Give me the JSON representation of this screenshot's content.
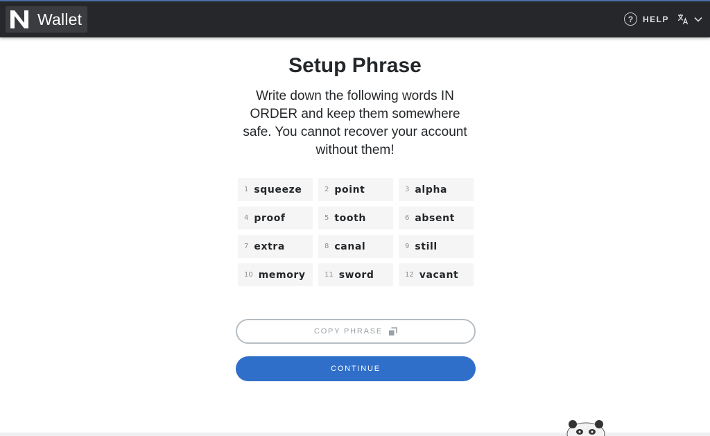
{
  "header": {
    "brand_text": "Wallet",
    "help_label": "HELP",
    "help_icon_glyph": "?",
    "colors": {
      "background": "#25272a",
      "text": "#ffffff"
    }
  },
  "main": {
    "title": "Setup Phrase",
    "subtitle": "Write down the following words IN ORDER and keep them somewhere safe. You cannot recover your account without them!",
    "words": [
      {
        "num": "1",
        "word": "squeeze"
      },
      {
        "num": "2",
        "word": "point"
      },
      {
        "num": "3",
        "word": "alpha"
      },
      {
        "num": "4",
        "word": "proof"
      },
      {
        "num": "5",
        "word": "tooth"
      },
      {
        "num": "6",
        "word": "absent"
      },
      {
        "num": "7",
        "word": "extra"
      },
      {
        "num": "8",
        "word": "canal"
      },
      {
        "num": "9",
        "word": "still"
      },
      {
        "num": "10",
        "word": "memory"
      },
      {
        "num": "11",
        "word": "sword"
      },
      {
        "num": "12",
        "word": "vacant"
      }
    ],
    "copy_button_label": "COPY PHRASE",
    "continue_button_label": "CONTINUE",
    "colors": {
      "primary": "#2f6fc9",
      "outline": "#b6bdc3"
    }
  },
  "icons": {
    "logo": "near-logo-icon",
    "help": "help-circle-icon",
    "language": "translate-icon",
    "dropdown": "chevron-down-icon",
    "copy": "copy-icon",
    "mascot": "panda-mascot-icon"
  }
}
